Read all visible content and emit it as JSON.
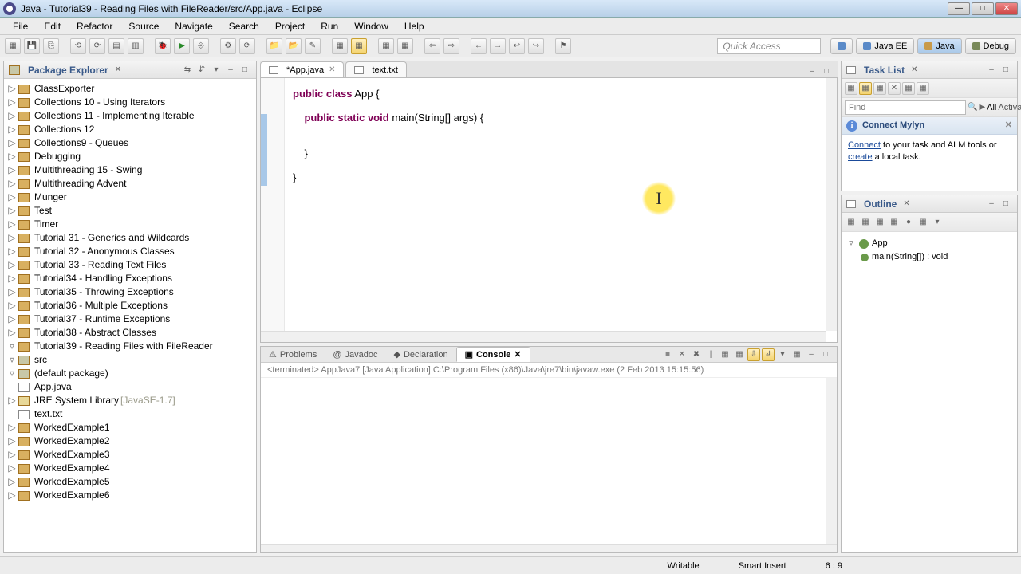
{
  "window": {
    "title": "Java - Tutorial39 - Reading Files with FileReader/src/App.java - Eclipse"
  },
  "menu": [
    "File",
    "Edit",
    "Refactor",
    "Source",
    "Navigate",
    "Search",
    "Project",
    "Run",
    "Window",
    "Help"
  ],
  "quick_access_placeholder": "Quick Access",
  "perspectives": {
    "javaee": "Java EE",
    "java": "Java",
    "debug": "Debug"
  },
  "package_explorer": {
    "title": "Package Explorer",
    "items": [
      "ClassExporter",
      "Collections 10 - Using Iterators",
      "Collections 11 - Implementing Iterable",
      "Collections 12",
      "Collections9 - Queues",
      "Debugging",
      "Multithreading 15 - Swing",
      "Multithreading Advent",
      "Munger",
      "Test",
      "Timer",
      "Tutorial 31 - Generics and Wildcards",
      "Tutorial 32 - Anonymous Classes",
      "Tutorial 33 - Reading Text Files",
      "Tutorial34 - Handling Exceptions",
      "Tutorial35 - Throwing Exceptions",
      "Tutorial36 - Multiple Exceptions",
      "Tutorial37 - Runtime Exceptions",
      "Tutorial38 - Abstract Classes"
    ],
    "expanded": {
      "name": "Tutorial39 - Reading Files with FileReader",
      "src": "src",
      "pkg": "(default package)",
      "file": "App.java",
      "jre": "JRE System Library",
      "jrev": "[JavaSE-1.7]",
      "txt": "text.txt"
    },
    "after": [
      "WorkedExample1",
      "WorkedExample2",
      "WorkedExample3",
      "WorkedExample4",
      "WorkedExample5",
      "WorkedExample6"
    ]
  },
  "editor": {
    "tabs": {
      "active": "*App.java",
      "other": "text.txt"
    },
    "line1a": "public",
    "line1b": "class",
    "line1c": "App {",
    "line2a": "public",
    "line2b": "static",
    "line2c": "void",
    "line2d": "main(String[] args) {",
    "line3": "    }",
    "line4": "}"
  },
  "console": {
    "tabs": {
      "problems": "Problems",
      "javadoc": "Javadoc",
      "declaration": "Declaration",
      "console": "Console"
    },
    "header": "<terminated> AppJava7 [Java Application] C:\\Program Files (x86)\\Java\\jre7\\bin\\javaw.exe (2 Feb 2013 15:15:56)"
  },
  "tasklist": {
    "title": "Task List",
    "find": "Find",
    "all": "All",
    "activate": "Activate...",
    "mylyn_hd": "Connect Mylyn",
    "mylyn_link1": "Connect",
    "mylyn_txt1": " to your task and ALM tools or ",
    "mylyn_link2": "create",
    "mylyn_txt2": " a local task."
  },
  "outline": {
    "title": "Outline",
    "cls": "App",
    "method": "main(String[]) : void"
  },
  "status": {
    "writable": "Writable",
    "insert": "Smart Insert",
    "pos": "6 : 9"
  }
}
